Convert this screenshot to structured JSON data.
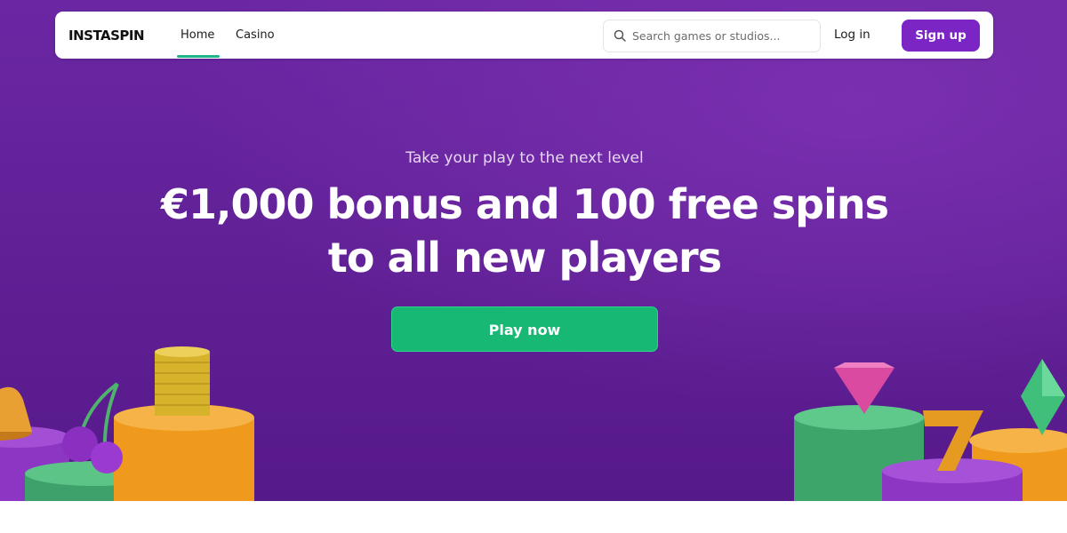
{
  "header": {
    "logo_text": "INSTASPIN",
    "nav": [
      {
        "label": "Home",
        "active": true
      },
      {
        "label": "Casino",
        "active": false
      }
    ],
    "search": {
      "placeholder": "Search games or studios..."
    },
    "login_label": "Log in",
    "signup_label": "Sign up"
  },
  "hero": {
    "tagline": "Take your play to the next level",
    "headline": "€1,000 bonus and 100 free spins to all new players",
    "cta_label": "Play now"
  },
  "colors": {
    "hero_background": "#5e1f93",
    "accent_purple": "#7a25c4",
    "cta_green": "#16b873",
    "active_tab_underline": "#1fb58a"
  },
  "icons": {
    "search": "search-icon",
    "decorations": [
      "bell-icon",
      "cherries-icon",
      "coin-stack-icon",
      "diamond-icon",
      "lucky-seven-icon",
      "gem-icon"
    ]
  }
}
